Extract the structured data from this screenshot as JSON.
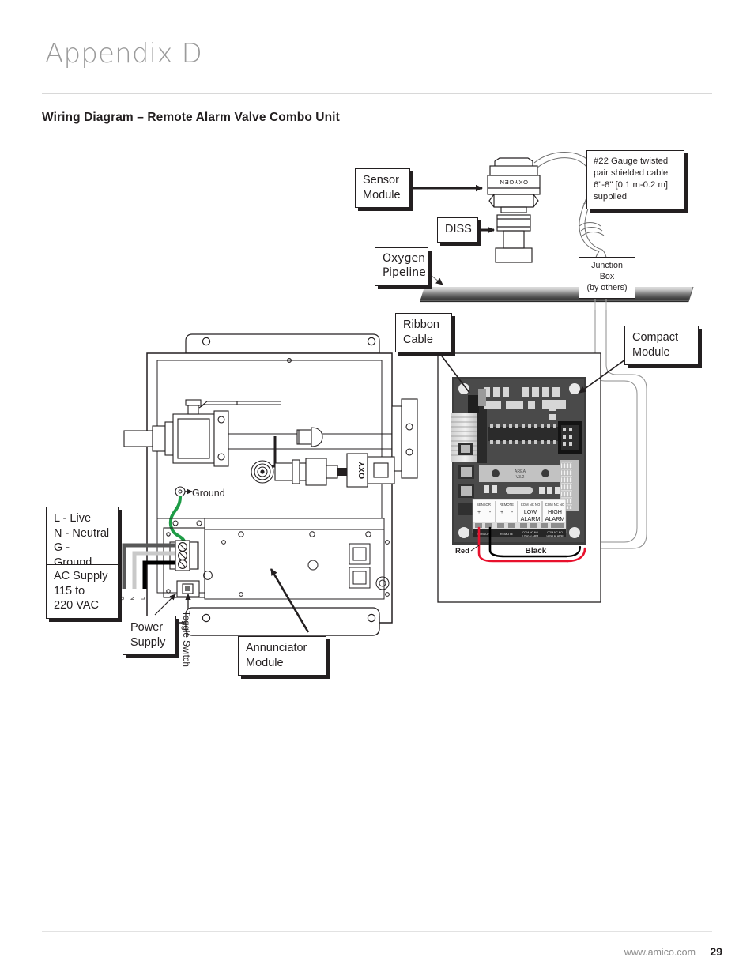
{
  "header": {
    "appendix_title": "Appendix D",
    "section_heading": "Wiring Diagram – Remote Alarm Valve Combo Unit"
  },
  "footer": {
    "website": "www.amico.com",
    "page_number": "29"
  },
  "callouts": {
    "sensor_module": "Sensor\nModule",
    "diss": "DISS",
    "oxygen_pipeline": "Oxygen\nPipeline",
    "cable_spec": "#22 Gauge twisted\npair shielded cable\n6\"-8\" [0.1 m-0.2 m]\nsupplied",
    "junction_box": "Junction Box\n(by others)",
    "ribbon_cable": "Ribbon\nCable",
    "compact_module": "Compact\nModule",
    "annunciator_module": "Annunciator\nModule",
    "power_supply": "Power\nSupply",
    "toggle_switch": "Toggle Switch",
    "ground": "Ground",
    "ac_supply": "AC Supply\n115 to\n220 VAC",
    "wire_legend": "L - Live\nN - Neutral\nG - Ground"
  },
  "board": {
    "terminal_groups": [
      {
        "name": "SENSOR",
        "pins": [
          "+",
          "-"
        ]
      },
      {
        "name": "REMOTE",
        "pins": [
          "+",
          "-"
        ]
      },
      {
        "name": "LOW\nALARM",
        "pins": [
          "COM",
          "NC",
          "NO"
        ]
      },
      {
        "name": "HIGH\nALARM",
        "pins": [
          "COM",
          "NC",
          "NO"
        ]
      }
    ],
    "terminal_strip_labels": [
      "SENSOR",
      "REMOTE",
      "LOW ALARM",
      "HIGH ALARM"
    ],
    "wire_red_label": "Red",
    "wire_black_label": "Black",
    "chip_text": "AREA\nV3.2"
  },
  "sensor": {
    "body_text": "OXYGEN"
  },
  "valve": {
    "gas_label": "OXY"
  },
  "terminal_block": {
    "pin_labels": [
      "L",
      "N",
      "G"
    ]
  },
  "colors": {
    "ink": "#231f20",
    "title_gray": "#9b9b9b",
    "wire_red": "#e8112d",
    "wire_black": "#000000",
    "wire_ground_green": "#1e9c46",
    "pipeline_gray": "#8a8a8a",
    "pcb_dark": "#3b3b3b"
  }
}
